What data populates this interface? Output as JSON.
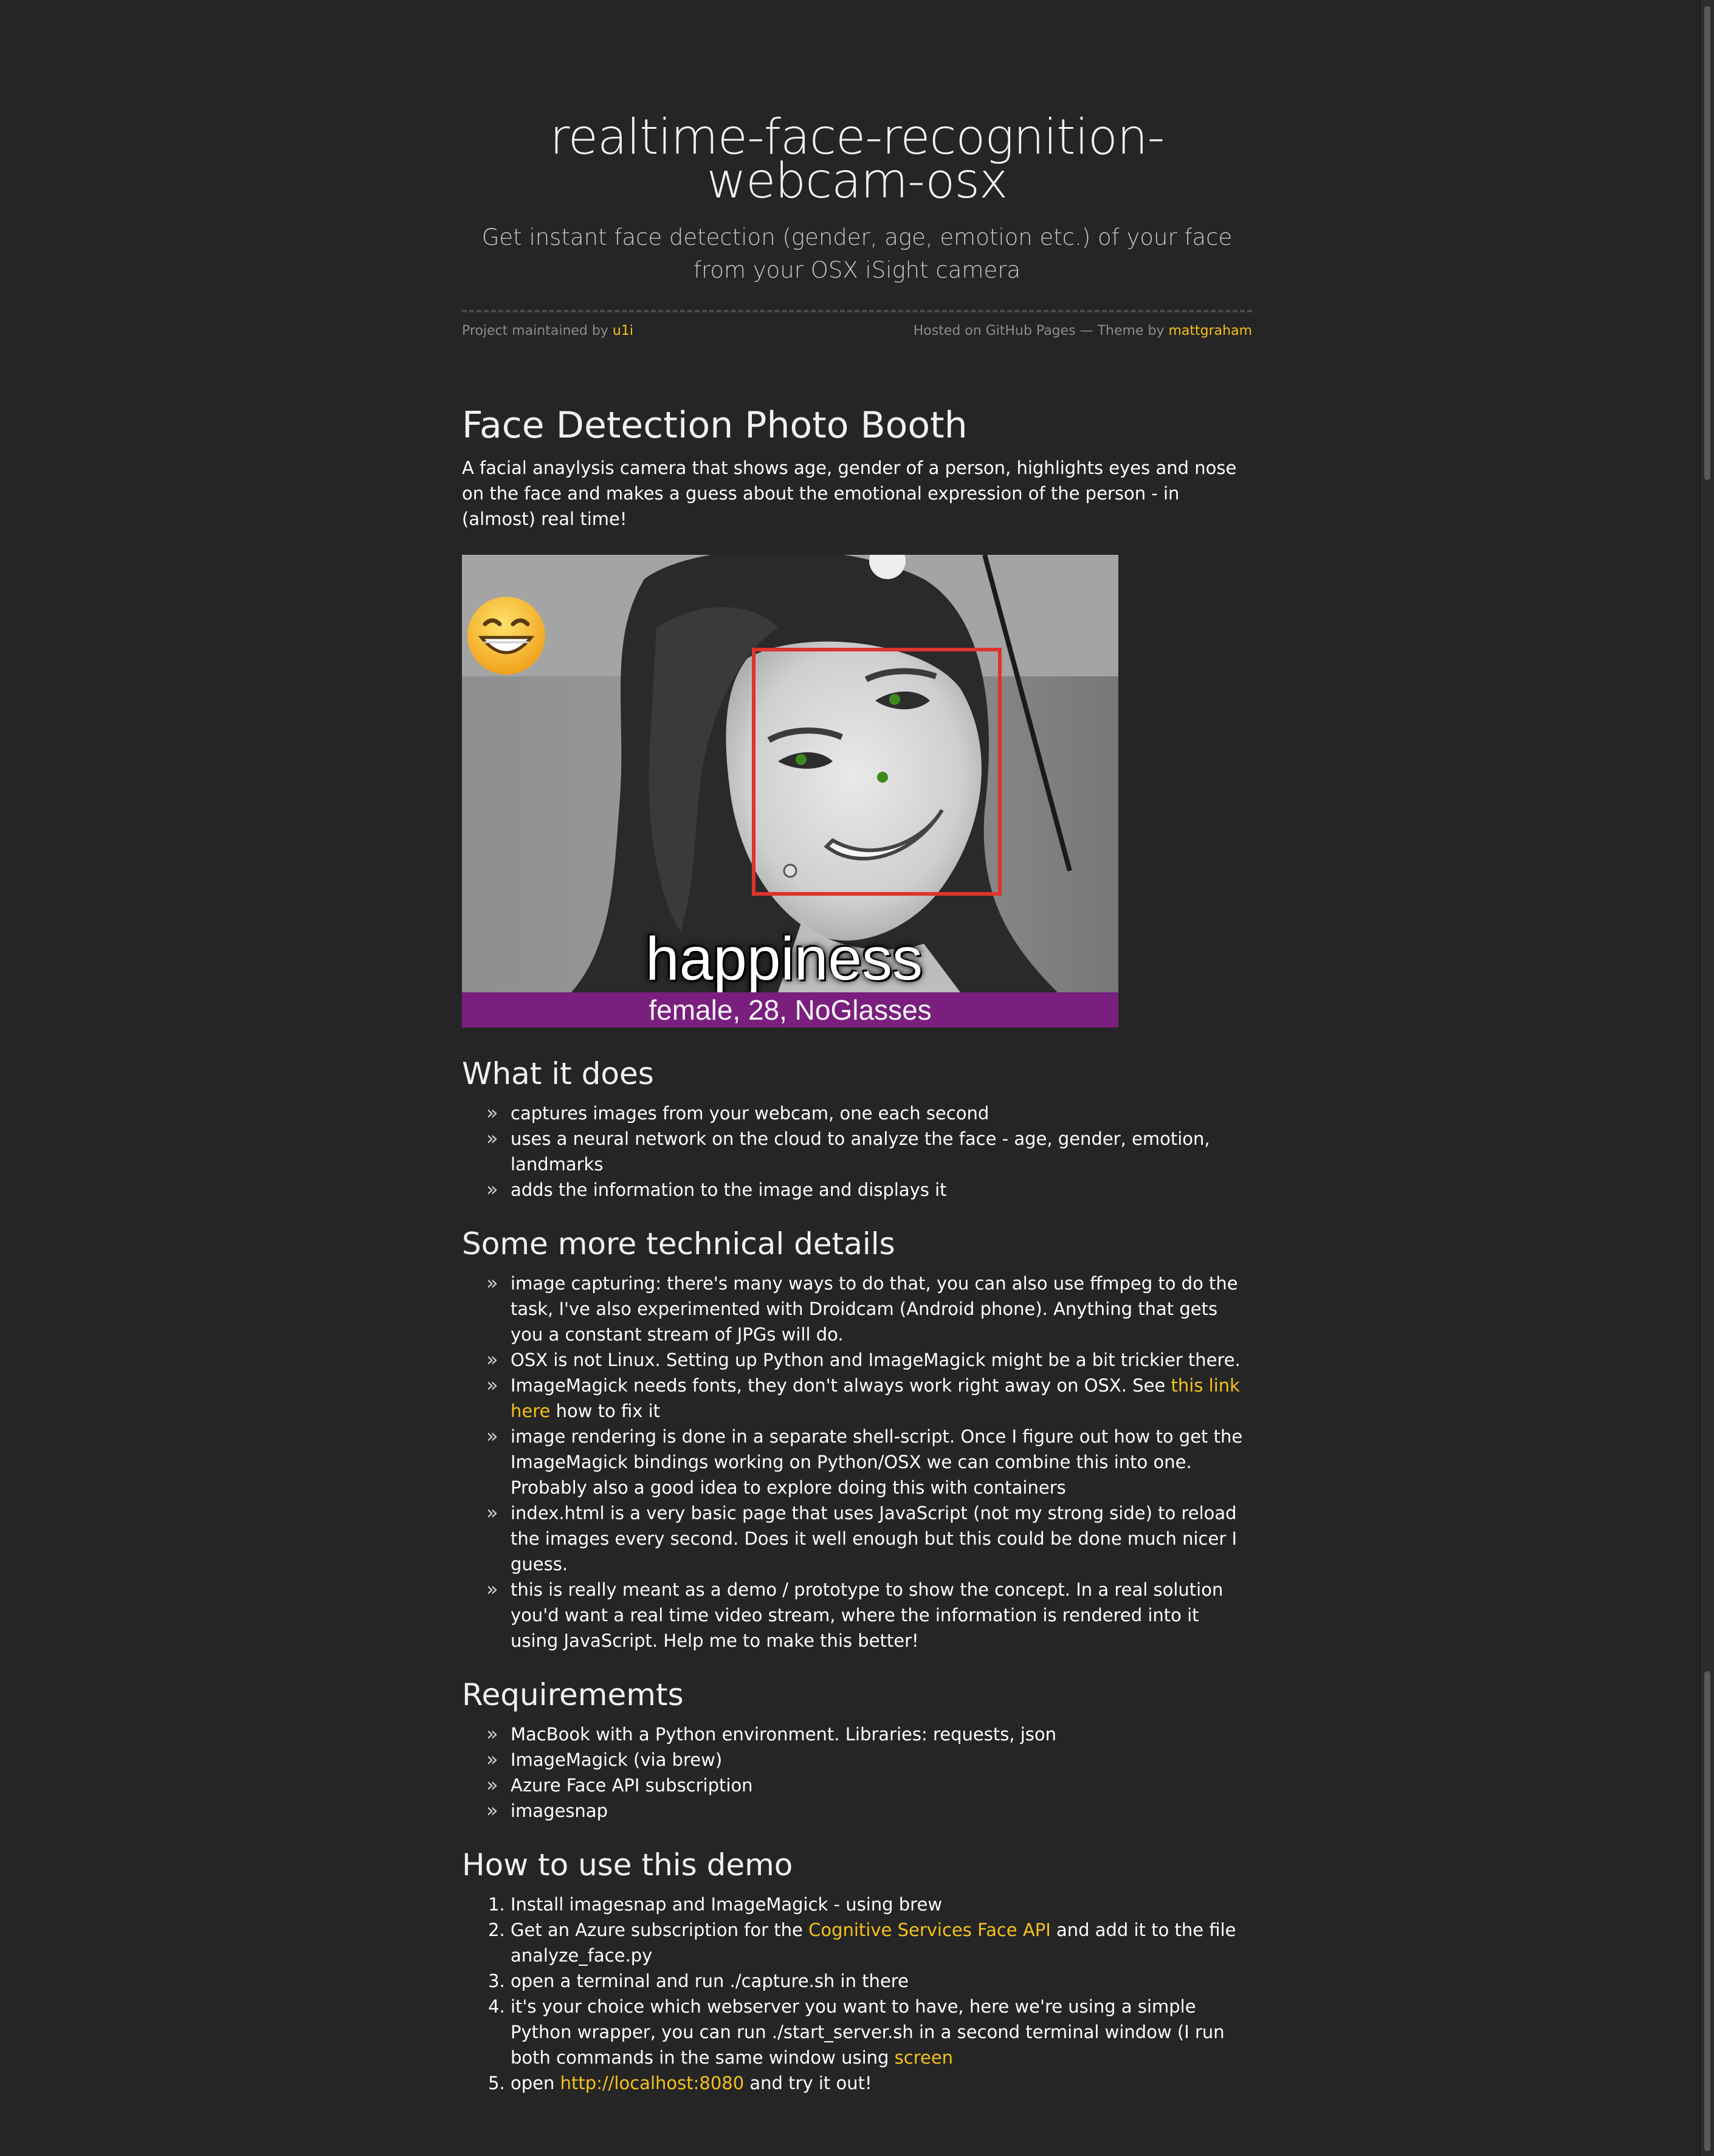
{
  "header": {
    "title": "realtime-face-recognition-webcam-osx",
    "tagline": "Get instant face detection (gender, age, emotion etc.) of your face from your OSX iSight camera",
    "maintained_prefix": "Project maintained by",
    "maintainer": "u1i",
    "hosted_prefix": "Hosted on GitHub Pages — Theme by",
    "theme_author": "mattgraham"
  },
  "colors": {
    "background": "#252525",
    "link": "#f5c21a",
    "text": "#ffffff",
    "muted": "#8c8c8c",
    "band": "#7a1f7e"
  },
  "intro": {
    "title": "Face Detection Photo Booth",
    "text": "A facial anaylysis camera that shows age, gender of a person, highlights eyes and nose on the face and makes a guess about the emotional expression of the person - in (almost) real time!"
  },
  "photo": {
    "emotion": "happiness",
    "info": "female, 28, NoGlasses",
    "emoji_icon": "grinning-face-emoji"
  },
  "what_it_does": {
    "title": "What it does",
    "items": [
      "captures images from your webcam, one each second",
      "uses a neural network on the cloud to analyze the face - age, gender, emotion, landmarks",
      "adds the information to the image and displays it"
    ]
  },
  "tech": {
    "title": "Some more technical details",
    "items": [
      "image capturing: there's many ways to do that, you can also use ffmpeg to do the task, I've also experimented with Droidcam (Android phone). Anything that gets you a constant stream of JPGs will do.",
      "OSX is not Linux. Setting up Python and ImageMagick might be a bit trickier there.",
      {
        "before": "ImageMagick needs fonts, they don't always work right away on OSX. See ",
        "link": "this link here",
        "after": " how to fix it"
      },
      "image rendering is done in a separate shell-script. Once I figure out how to get the ImageMagick bindings working on Python/OSX we can combine this into one. Probably also a good idea to explore doing this with containers",
      "index.html is a very basic page that uses JavaScript (not my strong side) to reload the images every second. Does it well enough but this could be done much nicer I guess.",
      "this is really meant as a demo / prototype to show the concept. In a real solution you'd want a real time video stream, where the information is rendered into it using JavaScript. Help me to make this better!"
    ]
  },
  "requirements": {
    "title": "Requirememts",
    "items": [
      "MacBook with a Python environment. Libraries: requests, json",
      "ImageMagick (via brew)",
      "Azure Face API subscription",
      "imagesnap"
    ]
  },
  "howto": {
    "title": "How to use this demo",
    "step1": "Install imagesnap and ImageMagick - using brew",
    "step2_before": "Get an Azure subscription for the ",
    "step2_link": "Cognitive Services Face API",
    "step2_after": " and add it to the file analyze_face.py",
    "step3": "open a terminal and run ./capture.sh in there",
    "step4_before": "it's your choice which webserver you want to have, here we're using a simple Python wrapper, you can run ./start_server.sh in a second terminal window (I run both commands in the same window using ",
    "step4_link": "screen",
    "step4_after": "",
    "step5_before": "open ",
    "step5_link": "http://localhost:8080",
    "step5_after": " and try it out!"
  }
}
